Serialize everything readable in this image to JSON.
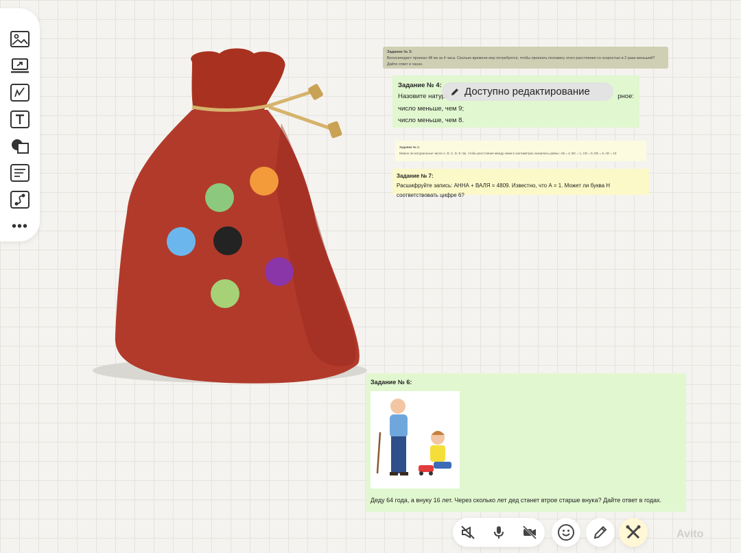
{
  "cards": {
    "task3": {
      "title": "Задание № 3:",
      "text": "Велосипедист проехал 48 км за 4 часа. Сколько времени ему потребуется, чтобы проехать половину этого расстояния со скоростью в 2 раза меньшей? Дайте ответ в часах."
    },
    "task4": {
      "title": "Задание № 4:",
      "line1": "Назовите натура",
      "line1_end": "рное:",
      "line2": "число меньше, чем 9;",
      "line3": "число меньше, чем 8."
    },
    "task1": {
      "title": "Задание № 1:",
      "text": "Можно ли натуральные числа A, B, C, D, E так, чтобы расстояния между ними в сантиметрах оказались равны: AB = 4, BC = 1, CD = 8, DE = 6, AE = 10"
    },
    "task7": {
      "title": "Задание № 7:",
      "text": "Расшифруйте запись: АННА + ВАЛЯ = 4809. Известно, что А = 1. Может ли буква Н соответствовать цифре 6?"
    },
    "task6": {
      "title": "Задание № 6:",
      "text": "Деду 64 года, а внуку 16 лет. Через сколько лет дед станет втрое старше внука? Дайте ответ в годах."
    }
  },
  "edit_pill": {
    "label": "Доступно редактирование"
  },
  "toolbar": {
    "more": "•••"
  },
  "watermark": "Avito",
  "colors": {
    "sack": "#b23a2b",
    "dots": [
      "#f39a3b",
      "#8cc97f",
      "#6cb6ee",
      "#232323",
      "#8a35a8",
      "#a6d177"
    ]
  }
}
